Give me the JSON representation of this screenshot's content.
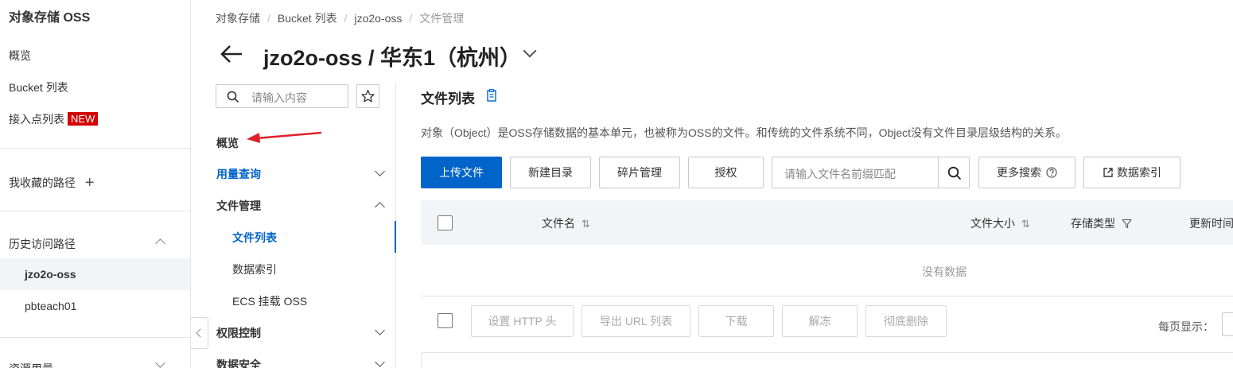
{
  "leftnav": {
    "title": "对象存储 OSS",
    "items": {
      "overview": "概览",
      "bucket_list": "Bucket 列表",
      "access_points": "接入点列表",
      "access_points_badge": "NEW",
      "favorites": "我收藏的路径",
      "favorites_add": "+",
      "history": "历史访问路径",
      "history_items": [
        "jzo2o-oss",
        "pbteach01"
      ],
      "resources": "资源用量"
    }
  },
  "breadcrumb": [
    "对象存储",
    "Bucket 列表",
    "jzo2o-oss",
    "文件管理"
  ],
  "header": {
    "title": "jzo2o-oss / 华东1（杭州）"
  },
  "subnav": {
    "search_placeholder": "请输入内容",
    "items": {
      "overview": "概览",
      "usage": "用量查询",
      "file_mgmt": "文件管理",
      "file_list": "文件列表",
      "data_index": "数据索引",
      "ecs_mount": "ECS 挂载 OSS",
      "access_control": "权限控制",
      "data_security": "数据安全"
    }
  },
  "main": {
    "title": "文件列表",
    "description": "对象（Object）是OSS存储数据的基本单元，也被称为OSS的文件。和传统的文件系统不同，Object没有文件目录层级结构的关系。",
    "buttons": {
      "upload": "上传文件",
      "new_dir": "新建目录",
      "fragments": "碎片管理",
      "authorize": "授权",
      "more_search": "更多搜索",
      "data_index": "数据索引"
    },
    "search_placeholder": "请输入文件名前缀匹配",
    "table": {
      "columns": [
        "文件名",
        "文件大小",
        "存储类型",
        "更新时间"
      ],
      "empty": "没有数据"
    },
    "bulk_actions": [
      "设置 HTTP 头",
      "导出 URL 列表",
      "下载",
      "解冻",
      "彻底删除"
    ],
    "per_page_label": "每页显示："
  },
  "colors": {
    "primary": "#0064c8",
    "badge": "#d40000",
    "annotation_arrow": "#e0202a"
  }
}
